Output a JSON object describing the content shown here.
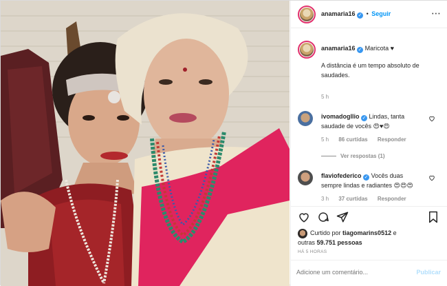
{
  "header": {
    "username": "anamaria16",
    "follow_label": "Seguir",
    "separator": "•",
    "more_label": "⋯"
  },
  "caption": {
    "username": "anamaria16",
    "text_title": "Maricota ♥",
    "text_body": "A distância é um tempo absoluto de saudades.",
    "time": "5 h"
  },
  "comments": [
    {
      "username": "ivomadogllio",
      "text_1": "Lindas, tanta",
      "text_2": "saudade de vocês 😍♥😍",
      "time": "5 h",
      "likes": "86 curtidas",
      "reply": "Responder",
      "view_replies": "Ver respostas (1)"
    },
    {
      "username": "flaviofederico",
      "text_1": "Vocês duas",
      "text_2": "sempre lindas e radiantes 😍😍😍",
      "time": "3 h",
      "likes": "37 curtidas",
      "reply": "Responder"
    }
  ],
  "likes_line": {
    "prefix": "Curtido por",
    "user": "tiagomarins0512",
    "conj": "e",
    "others_prefix": "outras",
    "count": "59.751 pessoas"
  },
  "post_time": "HÁ 5 HORAS",
  "add_comment": {
    "placeholder": "Adicione um comentário...",
    "publish": "Publicar"
  },
  "icons": {
    "like": "heart-icon",
    "comment": "comment-icon",
    "share": "share-icon",
    "save": "bookmark-icon"
  },
  "colors": {
    "verified": "#3897f0",
    "link": "#0095f6",
    "muted": "#8e8e8e",
    "story_ring": "#e1306c"
  }
}
